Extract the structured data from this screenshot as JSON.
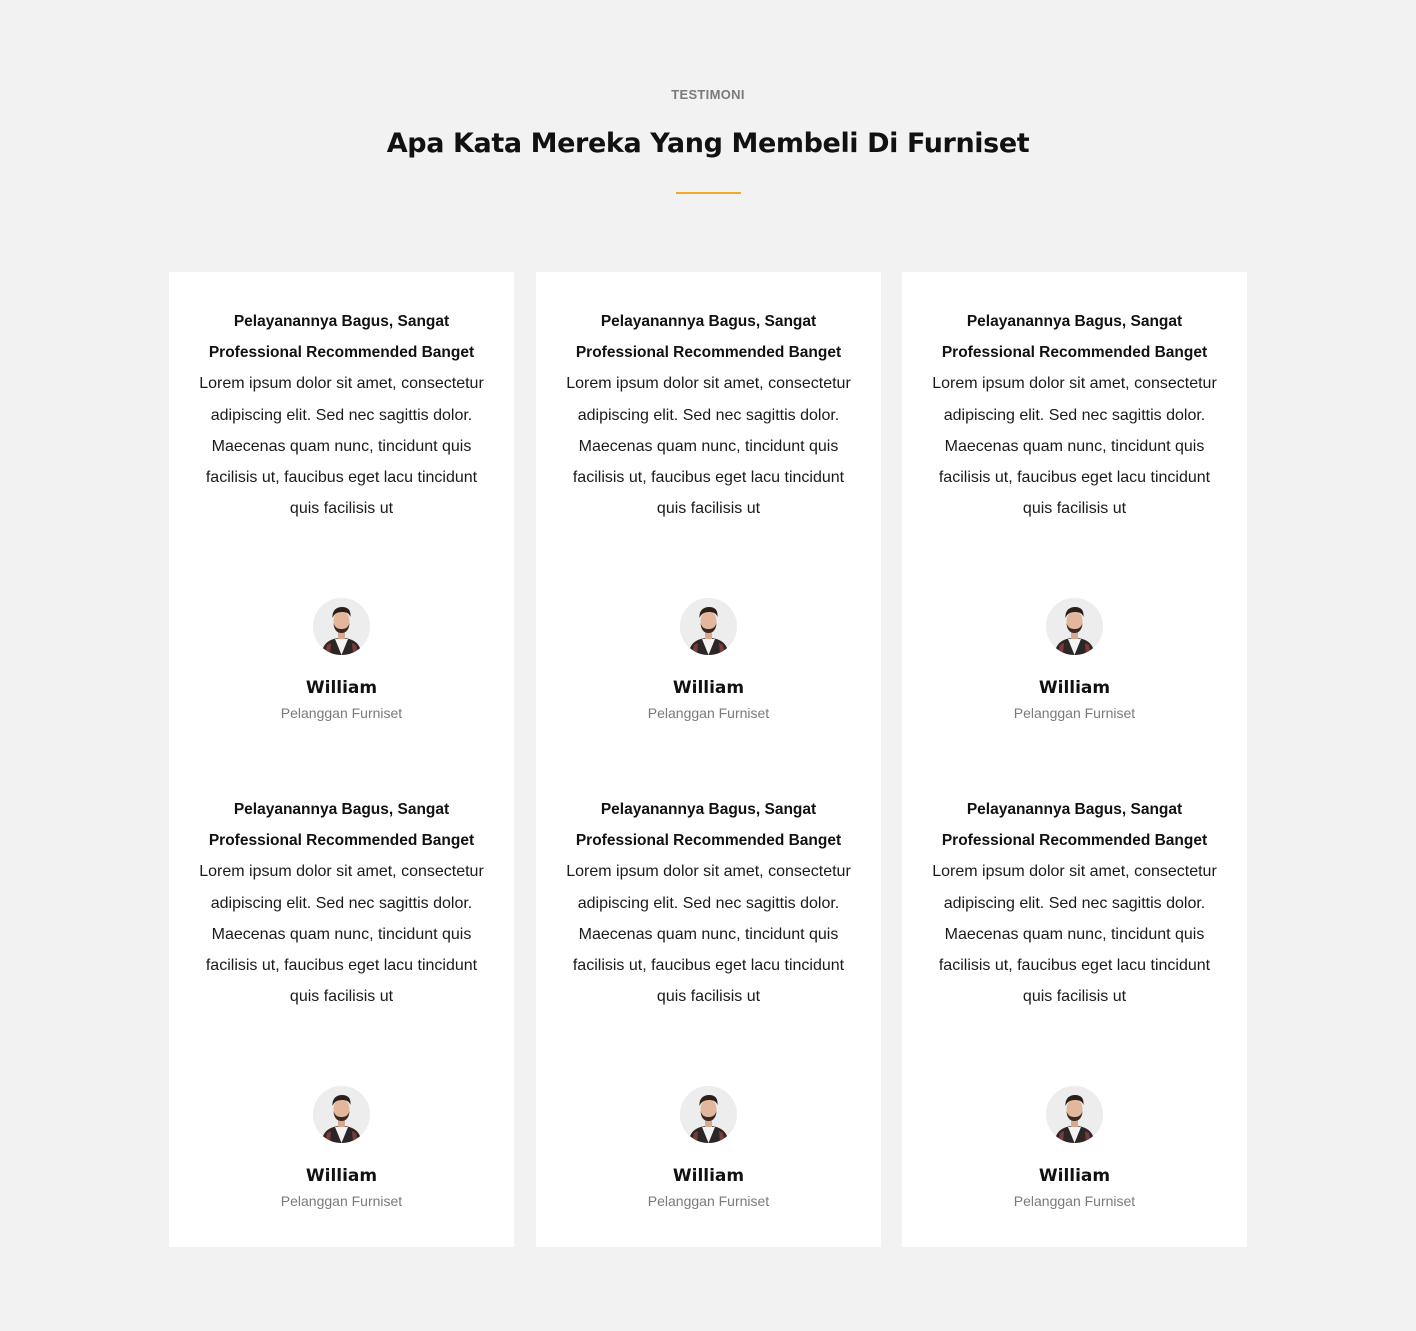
{
  "section": {
    "eyebrow": "TESTIMONI",
    "title": "Apa Kata Mereka Yang Membeli Di Furniset",
    "accent_color": "#f3a928",
    "background_color": "#f2f2f2"
  },
  "testimonials": [
    {
      "quote_title": "Pelayanannya Bagus, Sangat Professional Recommended Banget",
      "quote_body": "Lorem ipsum dolor sit amet, consectetur adipiscing elit. Sed nec sagittis dolor. Maecenas quam nunc, tincidunt quis facilisis ut, faucibus eget lacu tincidunt quis facilisis ut",
      "avatar_icon": "person-avatar",
      "name": "William",
      "role": "Pelanggan Furniset"
    },
    {
      "quote_title": "Pelayanannya Bagus, Sangat Professional Recommended Banget",
      "quote_body": "Lorem ipsum dolor sit amet, consectetur adipiscing elit. Sed nec sagittis dolor. Maecenas quam nunc, tincidunt quis facilisis ut, faucibus eget lacu tincidunt quis facilisis ut",
      "avatar_icon": "person-avatar",
      "name": "William",
      "role": "Pelanggan Furniset"
    },
    {
      "quote_title": "Pelayanannya Bagus, Sangat Professional Recommended Banget",
      "quote_body": "Lorem ipsum dolor sit amet, consectetur adipiscing elit. Sed nec sagittis dolor. Maecenas quam nunc, tincidunt quis facilisis ut, faucibus eget lacu tincidunt quis facilisis ut",
      "avatar_icon": "person-avatar",
      "name": "William",
      "role": "Pelanggan Furniset"
    },
    {
      "quote_title": "Pelayanannya Bagus, Sangat Professional Recommended Banget",
      "quote_body": "Lorem ipsum dolor sit amet, consectetur adipiscing elit. Sed nec sagittis dolor. Maecenas quam nunc, tincidunt quis facilisis ut, faucibus eget lacu tincidunt quis facilisis ut",
      "avatar_icon": "person-avatar",
      "name": "William",
      "role": "Pelanggan Furniset"
    },
    {
      "quote_title": "Pelayanannya Bagus, Sangat Professional Recommended Banget",
      "quote_body": "Lorem ipsum dolor sit amet, consectetur adipiscing elit. Sed nec sagittis dolor. Maecenas quam nunc, tincidunt quis facilisis ut, faucibus eget lacu tincidunt quis facilisis ut",
      "avatar_icon": "person-avatar",
      "name": "William",
      "role": "Pelanggan Furniset"
    },
    {
      "quote_title": "Pelayanannya Bagus, Sangat Professional Recommended Banget",
      "quote_body": "Lorem ipsum dolor sit amet, consectetur adipiscing elit. Sed nec sagittis dolor. Maecenas quam nunc, tincidunt quis facilisis ut, faucibus eget lacu tincidunt quis facilisis ut",
      "avatar_icon": "person-avatar",
      "name": "William",
      "role": "Pelanggan Furniset"
    }
  ]
}
